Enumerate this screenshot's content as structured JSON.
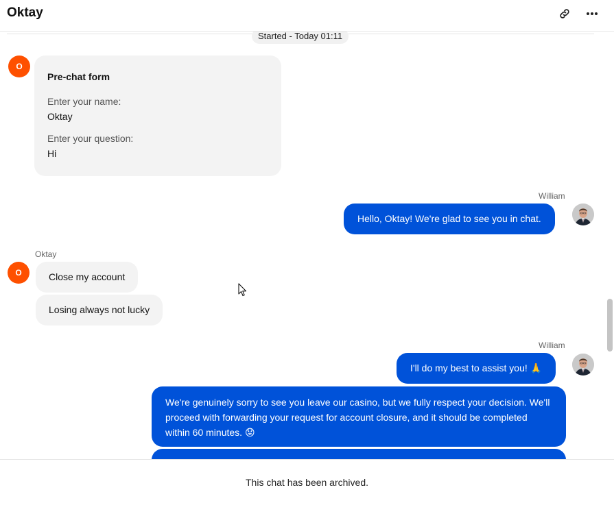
{
  "header": {
    "title": "Oktay"
  },
  "chat": {
    "started_label": "Started - Today 01:11",
    "prechat_form": {
      "title": "Pre-chat form",
      "name_label": "Enter your name:",
      "name_value": "Oktay",
      "question_label": "Enter your question:",
      "question_value": "Hi"
    },
    "visitor": {
      "name": "Oktay",
      "avatar_initial": "O"
    },
    "agent": {
      "name": "William"
    },
    "messages": [
      {
        "from": "agent",
        "sender": "William",
        "text": "Hello, Oktay! We're glad to see you in chat."
      },
      {
        "from": "visitor",
        "sender": "Oktay",
        "text": "Close my account"
      },
      {
        "from": "visitor",
        "text": "Losing always not lucky"
      },
      {
        "from": "agent",
        "sender": "William",
        "text": "I'll do my best to assist you! 🙏"
      },
      {
        "from": "agent",
        "text": "We're genuinely sorry to see you leave our casino, but we fully respect your decision. We'll proceed with forwarding your request for account closure, and it should be completed within 60 minutes. 😟"
      }
    ]
  },
  "footer": {
    "archived_text": "This chat has been archived."
  },
  "colors": {
    "agent_bubble": "#0052d9",
    "visitor_bubble": "#f3f3f3",
    "visitor_avatar": "#fe5000"
  }
}
